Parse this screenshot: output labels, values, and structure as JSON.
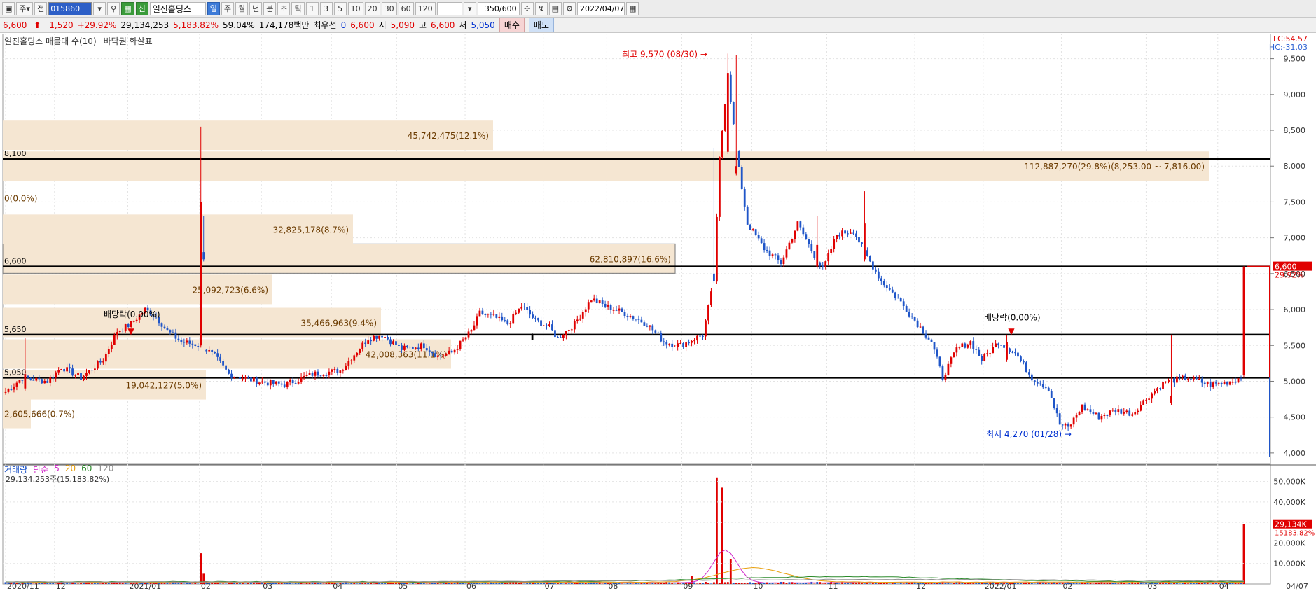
{
  "toolbar": {
    "code": "015860",
    "stock_name": "일진홀딩스",
    "mode_label": "주",
    "prev_label": "전",
    "credit_label": "신",
    "period_tabs": [
      "일",
      "주",
      "월",
      "년",
      "분",
      "초",
      "틱"
    ],
    "period_active": "일",
    "intervals": [
      "1",
      "3",
      "5",
      "10",
      "20",
      "30",
      "60",
      "120"
    ],
    "count": "350",
    "count_total": "/600",
    "date": "2022/04/07"
  },
  "quote": {
    "price": "6,600",
    "change": "1,520",
    "change_pct": "+29.92%",
    "volume": "29,134,253",
    "volume_pct": "5,183.82%",
    "turnover": "59.04%",
    "amount": "174,178백만",
    "best_label": "최우선",
    "best_val": "0",
    "best_ask": "6,600",
    "open_label": "시",
    "open": "5,090",
    "high_label": "고",
    "high": "6,600",
    "low_label": "저",
    "low": "5,050",
    "buy_label": "매수",
    "sell_label": "매도"
  },
  "legend": {
    "indicator": "일진홀딩스 매물대 수(10)",
    "indicator2": "바닥권 화살표",
    "vol_items": [
      "거래량",
      "단순",
      "5",
      "20",
      "60",
      "120"
    ],
    "vol_info": "29,134,253주(15,183.82%)"
  },
  "corner": {
    "lc": "LC:54.57",
    "hc": "HC:-31.03"
  },
  "colors": {
    "up": "#e00000",
    "down": "#1f55c8",
    "profile": "#f5e6d2",
    "ma5": "#d028c8",
    "ma20": "#e8a010",
    "ma60": "#2a8a2a",
    "ma120": "#909090"
  },
  "chart_data": {
    "type": "candlestick",
    "ylim": [
      3950,
      9750
    ],
    "y_ticks": [
      4000,
      4500,
      5000,
      5500,
      6000,
      6500,
      7000,
      7500,
      8000,
      8500,
      9000,
      9500
    ],
    "x_labels": [
      "2020/11",
      "12",
      "2021/01",
      "02",
      "03",
      "04",
      "05",
      "06",
      "07",
      "08",
      "09",
      "10",
      "11",
      "12",
      "2022/01",
      "02",
      "03",
      "04",
      "04/07"
    ],
    "h_lines": [
      {
        "label": "8,100",
        "value": 8100
      },
      {
        "label": "6,600",
        "value": 6600
      },
      {
        "label": "5,650",
        "value": 5650
      },
      {
        "label": "5,050",
        "value": 5050
      }
    ],
    "volume_profile": [
      {
        "label": "2,605,666(0.7%)",
        "price": 4550
      },
      {
        "label": "19,042,127(5.0%)",
        "price": 4950
      },
      {
        "label": "42,008,363(11.1%)",
        "price": 5380
      },
      {
        "label": "35,466,963(9.4%)",
        "price": 5820
      },
      {
        "label": "25,092,723(6.6%)",
        "price": 6280
      },
      {
        "label": "62,810,897(16.6%)",
        "price": 6710
      },
      {
        "label": "32,825,178(8.7%)",
        "price": 7120
      },
      {
        "label": "0(0.0%)",
        "price": 7560
      },
      {
        "label": "112,887,270(29.8%)(8,253.00 ~ 7,816.00)",
        "price": 8000
      },
      {
        "label": "45,742,475(12.1%)",
        "price": 8430
      }
    ],
    "annotations": {
      "high": "최고 9,570 (08/30)",
      "low": "최저 4,270 (01/28)",
      "dividend1": "배당락(0.00%)",
      "dividend2": "배당락(0.00%)"
    },
    "last_price_tag": "6,600",
    "last_pct_tag": "29.92%",
    "volume_ticks": [
      "50,000K",
      "40,000K",
      "30,000K",
      "20,000K",
      "10,000K"
    ],
    "volume_ylim": [
      0,
      55000
    ],
    "last_volume_tag": "29,134K",
    "last_volume_pct": "15183.82%",
    "price_anchors": [
      [
        0,
        4850
      ],
      [
        6,
        5050
      ],
      [
        15,
        5000
      ],
      [
        20,
        5200
      ],
      [
        27,
        5050
      ],
      [
        35,
        5300
      ],
      [
        40,
        5700
      ],
      [
        45,
        5800
      ],
      [
        50,
        6000
      ],
      [
        54,
        5900
      ],
      [
        58,
        5700
      ],
      [
        63,
        5550
      ],
      [
        70,
        5500
      ],
      [
        75,
        5350
      ],
      [
        80,
        5100
      ],
      [
        90,
        5000
      ],
      [
        100,
        4950
      ],
      [
        110,
        5100
      ],
      [
        120,
        5150
      ],
      [
        130,
        5600
      ],
      [
        135,
        5650
      ],
      [
        142,
        5450
      ],
      [
        150,
        5500
      ],
      [
        155,
        5350
      ],
      [
        160,
        5400
      ],
      [
        167,
        5700
      ],
      [
        170,
        5950
      ],
      [
        175,
        5900
      ],
      [
        180,
        5800
      ],
      [
        185,
        6050
      ],
      [
        190,
        5850
      ],
      [
        195,
        5750
      ],
      [
        198,
        5600
      ],
      [
        204,
        5800
      ],
      [
        210,
        6150
      ],
      [
        215,
        6050
      ],
      [
        222,
        5950
      ],
      [
        230,
        5800
      ],
      [
        236,
        5550
      ],
      [
        242,
        5500
      ],
      [
        250,
        5650
      ],
      [
        254,
        6400
      ],
      [
        256,
        8100
      ],
      [
        259,
        9300
      ],
      [
        262,
        8200
      ],
      [
        266,
        7200
      ],
      [
        272,
        6850
      ],
      [
        278,
        6650
      ],
      [
        284,
        7200
      ],
      [
        288,
        6900
      ],
      [
        293,
        6550
      ],
      [
        298,
        7050
      ],
      [
        304,
        7100
      ],
      [
        308,
        6800
      ],
      [
        314,
        6400
      ],
      [
        320,
        6150
      ],
      [
        326,
        5850
      ],
      [
        332,
        5550
      ],
      [
        336,
        5050
      ],
      [
        341,
        5450
      ],
      [
        346,
        5550
      ],
      [
        350,
        5300
      ],
      [
        356,
        5550
      ],
      [
        362,
        5400
      ],
      [
        368,
        5050
      ],
      [
        374,
        4900
      ],
      [
        378,
        4400
      ],
      [
        381,
        4350
      ],
      [
        386,
        4650
      ],
      [
        392,
        4500
      ],
      [
        398,
        4600
      ],
      [
        404,
        4550
      ],
      [
        410,
        4800
      ],
      [
        416,
        5000
      ],
      [
        424,
        5050
      ],
      [
        432,
        4950
      ],
      [
        440,
        5000
      ],
      [
        444,
        5080
      ]
    ],
    "spikes": [
      [
        7,
        4900,
        5600,
        5100
      ],
      [
        70,
        5500,
        8550,
        7500
      ],
      [
        71,
        6800,
        7300,
        6700
      ],
      [
        254,
        6500,
        8250,
        6400
      ],
      [
        259,
        8200,
        9570,
        9300
      ],
      [
        262,
        7900,
        9550,
        8000
      ],
      [
        291,
        6600,
        7300,
        6900
      ],
      [
        308,
        6700,
        7650,
        7200
      ],
      [
        359,
        5300,
        5650,
        5550
      ],
      [
        418,
        4700,
        5650,
        4800
      ]
    ],
    "vol_spikes": [
      [
        70,
        15000
      ],
      [
        71,
        5000
      ],
      [
        255,
        52000
      ],
      [
        257,
        47000
      ],
      [
        260,
        12000
      ],
      [
        246,
        4000
      ],
      [
        444,
        29134
      ]
    ]
  }
}
